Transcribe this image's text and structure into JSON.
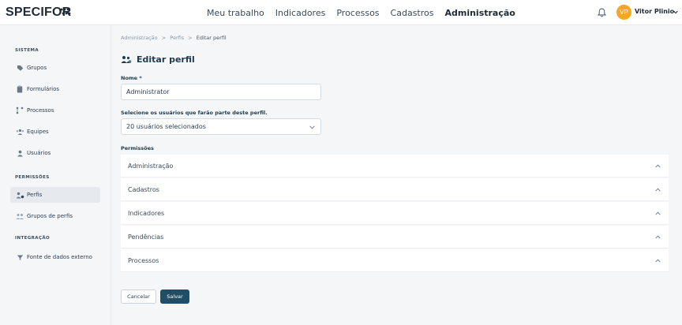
{
  "brand": {
    "logo_text": "SPECIFOR"
  },
  "nav": {
    "items": [
      "Meu trabalho",
      "Indicadores",
      "Processos",
      "Cadastros",
      "Administração"
    ],
    "active": "Administração"
  },
  "user": {
    "initials": "VP",
    "name": "Vitor Plinio",
    "avatar_color": "#f5a623"
  },
  "sidebar": {
    "sections": [
      {
        "title": "SISTEMA",
        "items": [
          {
            "label": "Grupos",
            "icon": "tag-icon"
          },
          {
            "label": "Formulários",
            "icon": "clipboard-icon"
          },
          {
            "label": "Processos",
            "icon": "flow-icon"
          },
          {
            "label": "Equipes",
            "icon": "team-icon"
          },
          {
            "label": "Usuários",
            "icon": "user-icon"
          }
        ]
      },
      {
        "title": "PERMISSÕES",
        "items": [
          {
            "label": "Perfis",
            "icon": "profile-gear-icon",
            "active": true
          },
          {
            "label": "Grupos de perfis",
            "icon": "profile-group-icon"
          }
        ]
      },
      {
        "title": "INTEGRAÇÃO",
        "items": [
          {
            "label": "Fonte de dados externo",
            "icon": "database-funnel-icon"
          }
        ]
      }
    ]
  },
  "breadcrumb": {
    "items": [
      "Administração",
      "Perfis",
      "Editar perfil"
    ],
    "separator": ">"
  },
  "page": {
    "title": "Editar perfil"
  },
  "form": {
    "name_label": "Nome *",
    "name_value": "Administrator",
    "users_label": "Selecione os usuários que farão parte deste perfil.",
    "users_value": "20 usuários selecionados",
    "permissions_label": "Permissões",
    "permissions": [
      "Administração",
      "Cadastros",
      "Indicadores",
      "Pendências",
      "Processos"
    ]
  },
  "actions": {
    "cancel": "Cancelar",
    "save": "Salvar"
  },
  "colors": {
    "accent": "#1f4e66",
    "title": "#1f3a4d"
  }
}
